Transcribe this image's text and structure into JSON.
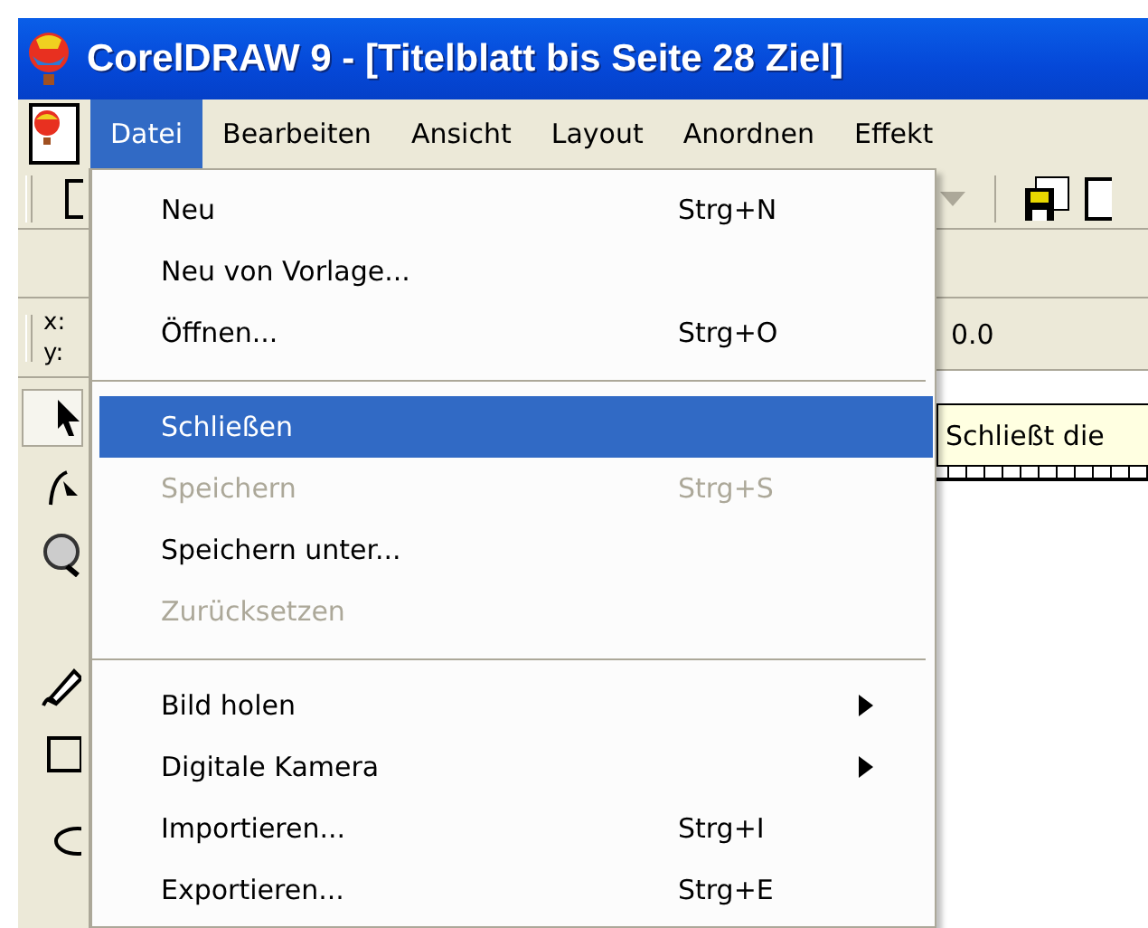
{
  "window": {
    "title": "CorelDRAW 9 - [Titelblatt bis Seite 28 Ziel]"
  },
  "menubar": [
    {
      "label": "Datei",
      "selected": true
    },
    {
      "label": "Bearbeiten",
      "selected": false
    },
    {
      "label": "Ansicht",
      "selected": false
    },
    {
      "label": "Layout",
      "selected": false
    },
    {
      "label": "Anordnen",
      "selected": false
    },
    {
      "label": "Effekt",
      "selected": false
    }
  ],
  "menu": [
    {
      "kind": "item",
      "label": "Neu",
      "shortcut": "Strg+N",
      "disabled": false,
      "selected": false,
      "submenu": false
    },
    {
      "kind": "item",
      "label": "Neu von Vorlage...",
      "disabled": false,
      "selected": false,
      "submenu": false
    },
    {
      "kind": "item",
      "label": "Öffnen...",
      "shortcut": "Strg+O",
      "disabled": false,
      "selected": false,
      "submenu": false
    },
    {
      "kind": "separator"
    },
    {
      "kind": "item",
      "label": "Schließen",
      "disabled": false,
      "selected": true,
      "submenu": false
    },
    {
      "kind": "item",
      "label": "Speichern",
      "shortcut": "Strg+S",
      "disabled": true,
      "selected": false,
      "submenu": false
    },
    {
      "kind": "item",
      "label": "Speichern unter...",
      "disabled": false,
      "selected": false,
      "submenu": false
    },
    {
      "kind": "item",
      "label": "Zurücksetzen",
      "disabled": true,
      "selected": false,
      "submenu": false
    },
    {
      "kind": "separator"
    },
    {
      "kind": "item",
      "label": "Bild holen",
      "disabled": false,
      "selected": false,
      "submenu": true
    },
    {
      "kind": "item",
      "label": "Digitale Kamera",
      "disabled": false,
      "selected": false,
      "submenu": true
    },
    {
      "kind": "item",
      "label": "Importieren...",
      "shortcut": "Strg+I",
      "disabled": false,
      "selected": false,
      "submenu": false
    },
    {
      "kind": "item",
      "label": "Exportieren...",
      "shortcut": "Strg+E",
      "disabled": false,
      "selected": false,
      "submenu": false
    }
  ],
  "property_bar": {
    "x_label": "x:",
    "y_label": "y:",
    "value": "0.0"
  },
  "tooltip": "Schließt die"
}
